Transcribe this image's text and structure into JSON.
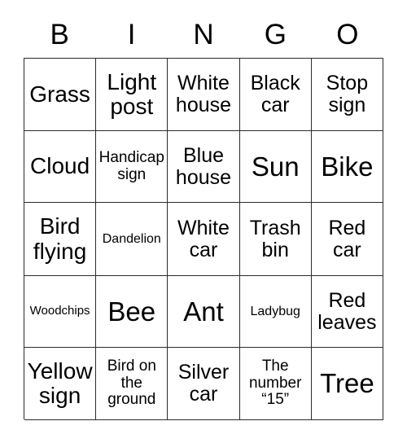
{
  "card": {
    "header_letters": [
      "B",
      "I",
      "N",
      "G",
      "O"
    ],
    "columns": 5,
    "rows": 5,
    "border_color": "#2b2b2b",
    "background_color": "#ffffff",
    "text_color": "#000000",
    "cells": [
      [
        {
          "text": "Grass",
          "size": "lg"
        },
        {
          "text": "Light post",
          "size": "lg"
        },
        {
          "text": "White house",
          "size": "md"
        },
        {
          "text": "Black car",
          "size": "md"
        },
        {
          "text": "Stop sign",
          "size": "md"
        }
      ],
      [
        {
          "text": "Cloud",
          "size": "lg"
        },
        {
          "text": "Handicap sign",
          "size": "sm"
        },
        {
          "text": "Blue house",
          "size": "md"
        },
        {
          "text": "Sun",
          "size": "xl"
        },
        {
          "text": "Bike",
          "size": "xl"
        }
      ],
      [
        {
          "text": "Bird flying",
          "size": "lg"
        },
        {
          "text": "Dandelion",
          "size": "xs"
        },
        {
          "text": "White car",
          "size": "md"
        },
        {
          "text": "Trash bin",
          "size": "md"
        },
        {
          "text": "Red car",
          "size": "md"
        }
      ],
      [
        {
          "text": "Woodchips",
          "size": "xxs"
        },
        {
          "text": "Bee",
          "size": "xl"
        },
        {
          "text": "Ant",
          "size": "xl"
        },
        {
          "text": "Ladybug",
          "size": "xs"
        },
        {
          "text": "Red leaves",
          "size": "md"
        }
      ],
      [
        {
          "text": "Yellow sign",
          "size": "lg"
        },
        {
          "text": "Bird on the ground",
          "size": "sm"
        },
        {
          "text": "Silver car",
          "size": "md"
        },
        {
          "text": "The number “15”",
          "size": "sm"
        },
        {
          "text": "Tree",
          "size": "xl"
        }
      ]
    ]
  }
}
